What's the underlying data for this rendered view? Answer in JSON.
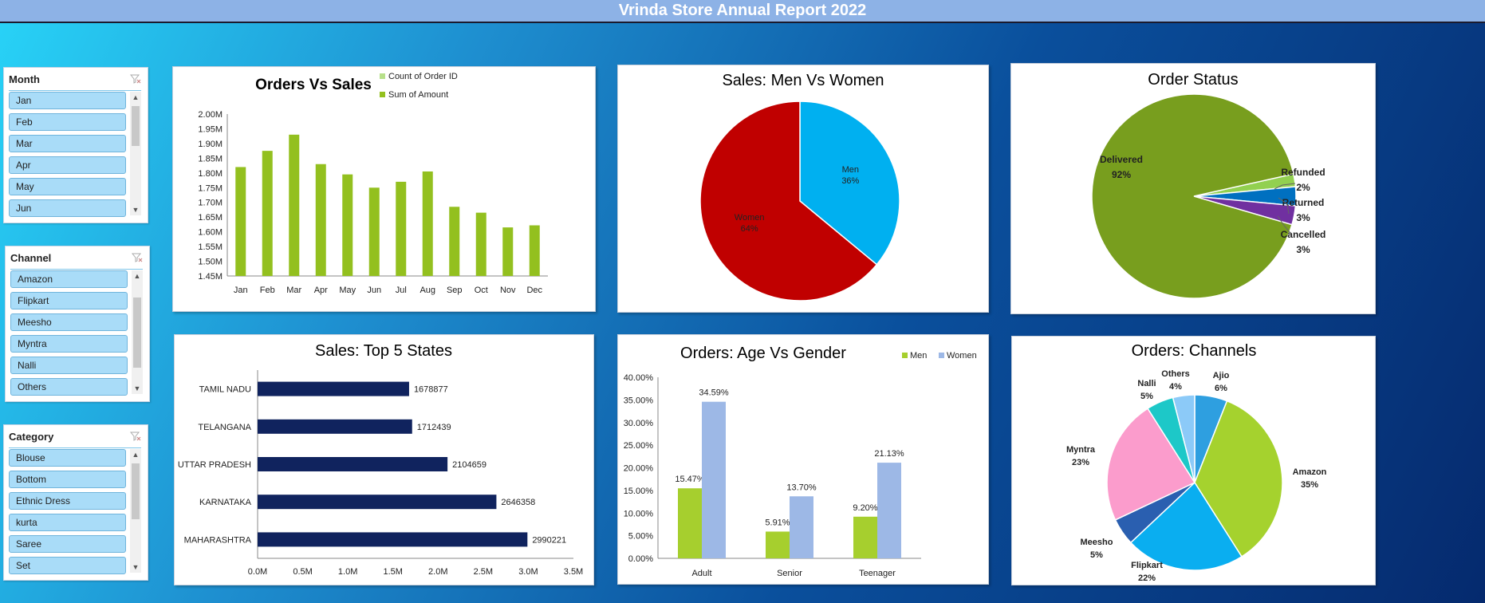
{
  "report_title": "Vrinda Store Annual Report 2022",
  "slicers": {
    "month": {
      "label": "Month",
      "items": [
        "Jan",
        "Feb",
        "Mar",
        "Apr",
        "May",
        "Jun"
      ]
    },
    "channel": {
      "label": "Channel",
      "items": [
        "Amazon",
        "Flipkart",
        "Meesho",
        "Myntra",
        "Nalli",
        "Others"
      ]
    },
    "category": {
      "label": "Category",
      "items": [
        "Blouse",
        "Bottom",
        "Ethnic Dress",
        "kurta",
        "Saree",
        "Set"
      ]
    }
  },
  "colors": {
    "green": "#93c01f",
    "light_green": "#b7e08a",
    "navy": "#10235e",
    "light_blue": "#9db8e6",
    "lime": "#a6cf2e",
    "red": "#c00000",
    "cyan": "#00b0f0"
  },
  "chart_data": [
    {
      "type": "bar",
      "title": "Orders Vs Sales",
      "categories": [
        "Jan",
        "Feb",
        "Mar",
        "Apr",
        "May",
        "Jun",
        "Jul",
        "Aug",
        "Sep",
        "Oct",
        "Nov",
        "Dec"
      ],
      "series": [
        {
          "name": "Count of Order ID",
          "values": []
        },
        {
          "name": "Sum of Amount",
          "values": [
            1.82,
            1.875,
            1.93,
            1.83,
            1.795,
            1.75,
            1.77,
            1.805,
            1.685,
            1.665,
            1.615,
            1.622
          ]
        }
      ],
      "ylim": [
        1.45,
        2.0
      ],
      "yticks": [
        "2.00M",
        "1.95M",
        "1.90M",
        "1.85M",
        "1.80M",
        "1.75M",
        "1.70M",
        "1.65M",
        "1.60M",
        "1.55M",
        "1.50M",
        "1.45M"
      ],
      "legend": "top-right"
    },
    {
      "type": "pie",
      "title": "Sales: Men Vs Women",
      "slices": [
        {
          "label": "Men",
          "pct": "36%",
          "value": 36,
          "color": "#00b0f0"
        },
        {
          "label": "Women",
          "pct": "64%",
          "value": 64,
          "color": "#c00000"
        }
      ]
    },
    {
      "type": "pie",
      "title": "Order Status",
      "slices": [
        {
          "label": "Delivered",
          "pct": "92%",
          "value": 92,
          "color": "#789e1e"
        },
        {
          "label": "Refunded",
          "pct": "2%",
          "value": 2,
          "color": "#92d050"
        },
        {
          "label": "Returned",
          "pct": "3%",
          "value": 3,
          "color": "#0070c0"
        },
        {
          "label": "Cancelled",
          "pct": "3%",
          "value": 3,
          "color": "#7030a0"
        }
      ]
    },
    {
      "type": "bar",
      "orientation": "horizontal",
      "title": "Sales: Top 5 States",
      "categories": [
        "TAMIL NADU",
        "TELANGANA",
        "UTTAR PRADESH",
        "KARNATAKA",
        "MAHARASHTRA"
      ],
      "values": [
        1678877,
        1712439,
        2104659,
        2646358,
        2990221
      ],
      "labels": [
        "1678877",
        "1712439",
        "2104659",
        "2646358",
        "2990221"
      ],
      "xlim": [
        0,
        3.5
      ],
      "xticks": [
        "0.0M",
        "0.5M",
        "1.0M",
        "1.5M",
        "2.0M",
        "2.5M",
        "3.0M",
        "3.5M"
      ]
    },
    {
      "type": "bar",
      "title": "Orders: Age Vs Gender",
      "categories": [
        "Adult",
        "Senior",
        "Teenager"
      ],
      "series": [
        {
          "name": "Men",
          "values": [
            15.47,
            5.91,
            9.2
          ],
          "labels": [
            "15.47%",
            "5.91%",
            "9.20%"
          ]
        },
        {
          "name": "Women",
          "values": [
            34.59,
            13.7,
            21.13
          ],
          "labels": [
            "34.59%",
            "13.70%",
            "21.13%"
          ]
        }
      ],
      "ylim": [
        0,
        40
      ],
      "yticks": [
        "40.00%",
        "35.00%",
        "30.00%",
        "25.00%",
        "20.00%",
        "15.00%",
        "10.00%",
        "5.00%",
        "0.00%"
      ],
      "legend": "top-right"
    },
    {
      "type": "pie",
      "title": "Orders: Channels",
      "slices": [
        {
          "label": "Ajio",
          "pct": "6%",
          "value": 6,
          "color": "#2e9fe0"
        },
        {
          "label": "Amazon",
          "pct": "35%",
          "value": 35,
          "color": "#a5d22e"
        },
        {
          "label": "Flipkart",
          "pct": "22%",
          "value": 22,
          "color": "#0aaef0"
        },
        {
          "label": "Meesho",
          "pct": "5%",
          "value": 5,
          "color": "#2a5fb0"
        },
        {
          "label": "Myntra",
          "pct": "23%",
          "value": 23,
          "color": "#fb9ccc"
        },
        {
          "label": "Nalli",
          "pct": "5%",
          "value": 5,
          "color": "#1dc8c8"
        },
        {
          "label": "Others",
          "pct": "4%",
          "value": 4,
          "color": "#8ccaf8"
        }
      ]
    }
  ]
}
